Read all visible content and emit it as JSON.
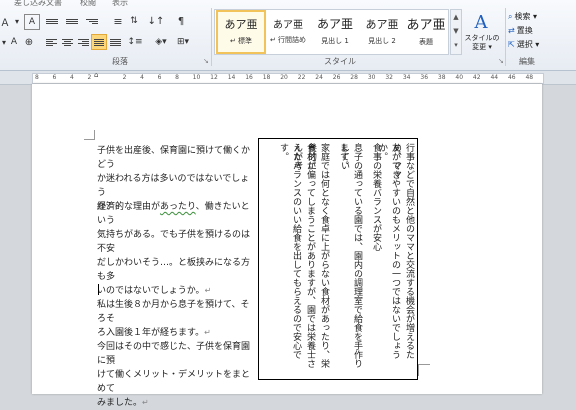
{
  "tabs": {
    "insert_doc": "差し込み文書",
    "review": "校閲",
    "view": "表示"
  },
  "paragraph_group": {
    "label": "段落"
  },
  "styles_group": {
    "label": "スタイル",
    "tiles": [
      {
        "sample": "あア亜",
        "name": "↵ 標準"
      },
      {
        "sample": "あア亜",
        "name": "↵ 行間詰め"
      },
      {
        "sample": "あア亜",
        "name": "見出し 1"
      },
      {
        "sample": "あア亜",
        "name": "見出し 2"
      },
      {
        "sample": "あア亜",
        "name": "表題"
      }
    ],
    "change_styles": "スタイルの\n変更 ▾"
  },
  "editing_group": {
    "label": "編集",
    "find": "検索 ▾",
    "replace": "置換",
    "select": "選択 ▾"
  },
  "ruler": {
    "numbers": [
      "8",
      "6",
      "4",
      "2",
      "",
      "2",
      "4",
      "6",
      "8",
      "10",
      "12",
      "14",
      "16",
      "18",
      "20",
      "22",
      "24",
      "26",
      "28",
      "30",
      "32",
      "34",
      "36",
      "38",
      "40",
      "42",
      "44",
      "46",
      "48"
    ]
  },
  "document": {
    "p1_lines": [
      "子供を出産後、保育園に預けて働くかどう",
      "か迷われる方は多いのではないでしょう",
      "か？"
    ],
    "p2_lines": [
      "経済的な理由があったり、働きたいという",
      "気持ちがある。でも子供を預けるのは不安",
      "だしかわいそう…。と板挟みになる方も多",
      "いのではないでしょうか。"
    ],
    "p3_lines": [
      "私は生後８か月から息子を預けて、そろそ",
      "ろ入園後１年が経ちます。"
    ],
    "p4_lines": [
      "今回はその中で感じた、子供を保育園に預",
      "けて働くメリット・デメリットをまとめて",
      "みました。"
    ],
    "p2_underlined": "あったり",
    "textbox_columns": [
      "行事などで自然と他のママと交流する機会が増えるため、ママ",
      "友ができやすいのもメリットの一つではないでしょうか。",
      "食事の栄養バランスが安心",
      "息子の通っている園では、園内の調理室で給食を手作りしてい",
      "ます。",
      "家庭では何となく食卓に上がらない食材があったり、栄養的に",
      "食材が偏ってしまうことがありますが、園では栄養士さんが考",
      "えたバランスのいい給食を出してもらえるので安心です。"
    ]
  }
}
